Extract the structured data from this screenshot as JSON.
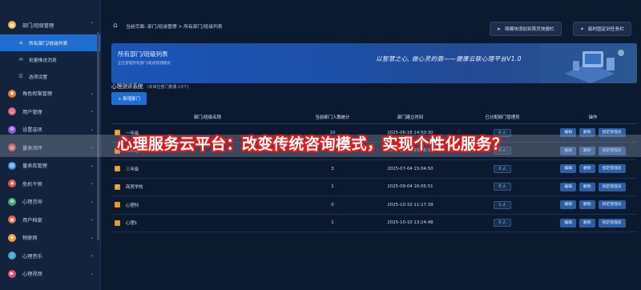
{
  "sidebar": {
    "items": [
      {
        "label": "部门/班级管理",
        "icon": "building-icon",
        "color": "#e8b13a",
        "expanded": true,
        "children": [
          {
            "label": "所有部门/班级列表",
            "active": true
          },
          {
            "label": "批量推送消息",
            "active": false
          },
          {
            "label": "选项设置",
            "active": false
          }
        ]
      },
      {
        "label": "角色权限管理",
        "icon": "role-icon",
        "color": "#e8762a"
      },
      {
        "label": "用户管理",
        "icon": "user-icon",
        "color": "#e05a6a"
      },
      {
        "label": "设置选项",
        "icon": "settings-icon",
        "color": "#8b5bd6"
      },
      {
        "label": "量表测评",
        "icon": "assessment-icon",
        "color": "#e04a4a"
      },
      {
        "label": "量表库管理",
        "icon": "library-icon",
        "color": "#3d8fe0"
      },
      {
        "label": "危机干预",
        "icon": "crisis-icon",
        "color": "#e0574a"
      },
      {
        "label": "心理咨询",
        "icon": "counsel-icon",
        "color": "#3fa86b"
      },
      {
        "label": "用户档案",
        "icon": "archive-icon",
        "color": "#e05f4a"
      },
      {
        "label": "物联网",
        "icon": "iot-icon",
        "color": "#e8a23a"
      },
      {
        "label": "心理音乐",
        "icon": "music-icon",
        "color": "#4aa5d6"
      },
      {
        "label": "心理视频",
        "icon": "video-icon",
        "color": "#e04a6a"
      }
    ]
  },
  "topbar": {
    "breadcrumb": "当前页面: 部门/班级管理 > 所有部门/班级列表",
    "quick_add_label": "将模块添加到首页快捷栏",
    "pin_task_label": "临时固定到任务栏"
  },
  "banner": {
    "title": "所有部门/班级列表",
    "subtitle": "正在管理所有部门/班级管理模式",
    "motto": "以智慧之心, 做心灵的盾——健康云联心理平台V1.0"
  },
  "section": {
    "title": "心理测评系统",
    "count": "(本单位部门数量:13个)",
    "add_button": "+ 新增部门"
  },
  "table": {
    "headers": [
      "部门/班级名称",
      "当前部门人数统计",
      "部门建立时间",
      "已分配部门管理员",
      "操作"
    ],
    "rows": [
      {
        "name": "一年级",
        "count": "10",
        "created": "2025-06-18 14:50:30",
        "admins": "0 人"
      },
      {
        "name": "二年级",
        "count": "3",
        "created": "2025-07-04 15:06:18",
        "admins": "0 人"
      },
      {
        "name": "三年级",
        "count": "3",
        "created": "2025-07-04 15:04:50",
        "admins": "0 人"
      },
      {
        "name": "商贸学校",
        "count": "1",
        "created": "2025-09-04 16:05:51",
        "admins": "0 人"
      },
      {
        "name": "心理科",
        "count": "0",
        "created": "2025-10-10 11:17:39",
        "admins": "1 人"
      },
      {
        "name": "心理1",
        "count": "1",
        "created": "2025-10-10 13:24:48",
        "admins": "0 人"
      }
    ],
    "actions": {
      "edit": "编辑",
      "delete": "删除",
      "assign": "指定管理员"
    }
  },
  "overlay": {
    "caption": "心理服务云平台：改变传统咨询模式，实现个性化服务？"
  },
  "colors": {
    "background": "#0c1a30",
    "sidebar": "#13233d",
    "accent": "#1f6ed4",
    "caption_stroke": "#e01b1b"
  }
}
